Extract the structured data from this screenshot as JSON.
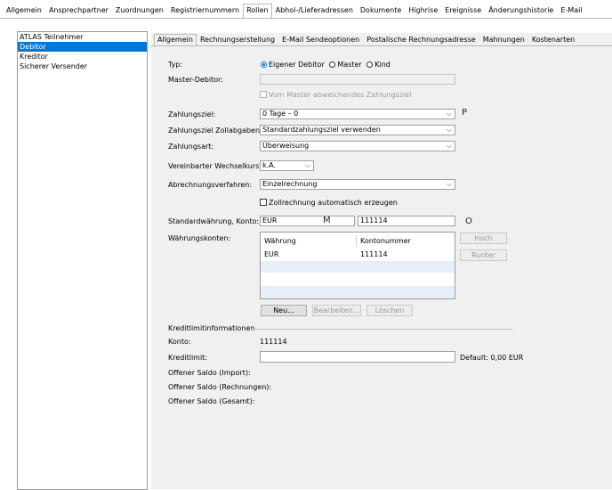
{
  "top_tabs": [
    "Allgemein",
    "Ansprechpartner",
    "Zuordnungen",
    "Registriernummern",
    "Rollen",
    "Abhol-/Lieferadressen",
    "Dokumente",
    "Highrise",
    "Ereignisse",
    "Änderungshistorie",
    "E-Mail"
  ],
  "top_tabs_active": "Rollen",
  "roles": [
    "ATLAS Teilnehmer",
    "Debitor",
    "Kreditor",
    "Sicherer Versender"
  ],
  "roles_selected": "Debitor",
  "sub_tabs": [
    "Allgemein",
    "Rechnungserstellung",
    "E-Mail Sendeoptionen",
    "Postalische Rechnungsadresse",
    "Mahnungen",
    "Kostenarten"
  ],
  "sub_tabs_active": "Allgemein",
  "form": {
    "typ_label": "Typ:",
    "typ_options": [
      "Eigener Debitor",
      "Master",
      "Kind"
    ],
    "master_debitor_label": "Master-Debitor:",
    "master_debitor_value": "",
    "abweichend_label": "Vom Master abweichendes Zahlungsziel",
    "zahlungsziel_label": "Zahlungsziel:",
    "zahlungsziel_value": "0 Tage – 0",
    "zahlungsziel_letter": "P",
    "zollabgaben_label": "Zahlungsziel Zollabgaben:",
    "zollabgaben_value": "Standardzahlungsziel verwenden",
    "zahlungsart_label": "Zahlungsart:",
    "zahlungsart_value": "Überweisung",
    "wechselkurs_label": "Vereinbarter Wechselkurstyp:",
    "wechselkurs_value": "k.A.",
    "abrechnung_label": "Abrechnungsverfahren:",
    "abrechnung_value": "Einzelrechnung",
    "zollrechnung_label": "Zollrechnung automatisch erzeugen",
    "waehrung_label": "Standardwährung, Konto:",
    "waehrung_value": "EUR",
    "waehrung_letter": "M",
    "konto_value": "111114",
    "konto_letter": "O",
    "waehrungskonten_label": "Währungskonten:",
    "grid_headers": [
      "Währung",
      "Kontonummer"
    ],
    "grid_rows": [
      [
        "EUR",
        "111114"
      ]
    ],
    "btn_hoch": "Hoch",
    "btn_runter": "Runter",
    "btn_neu": "Neu...",
    "btn_bearbeiten": "Bearbeiten...",
    "btn_loeschen": "Löschen"
  },
  "kredit": {
    "section_title": "Kreditlimitinformationen",
    "konto_label": "Konto:",
    "konto_value": "111114",
    "kreditlimit_label": "Kreditlimit:",
    "kreditlimit_value": "",
    "default_label": "Default:",
    "default_value": "0,00 EUR",
    "saldo_import_label": "Offener Saldo (Import):",
    "saldo_rechnungen_label": "Offener Saldo (Rechnungen):",
    "saldo_gesamt_label": "Offener Saldo (Gesamt):"
  }
}
